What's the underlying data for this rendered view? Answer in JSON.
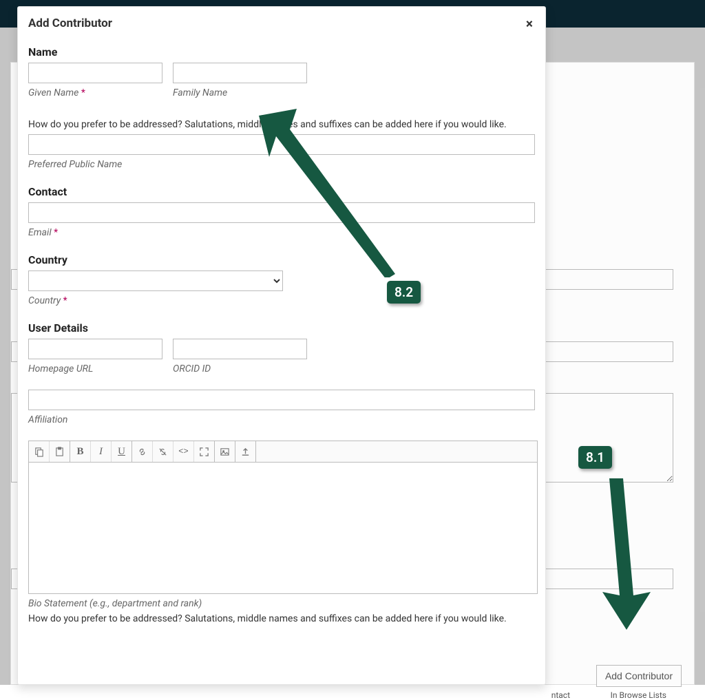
{
  "modal": {
    "title": "Add Contributor",
    "close_glyph": "×",
    "sections": {
      "name": {
        "heading": "Name",
        "given_label": "Given Name",
        "family_label": "Family Name",
        "helper": "How do you prefer to be addressed? Salutations, middle names and suffixes can be added here if you would like.",
        "preferred_label": "Preferred Public Name"
      },
      "contact": {
        "heading": "Contact",
        "email_label": "Email"
      },
      "country": {
        "heading": "Country",
        "country_label": "Country"
      },
      "user_details": {
        "heading": "User Details",
        "homepage_label": "Homepage URL",
        "orcid_label": "ORCID ID",
        "affiliation_label": "Affiliation",
        "bio_label": "Bio Statement (e.g., department and rank)",
        "helper2": "How do you prefer to be addressed? Salutations, middle names and suffixes can be added here if you would like."
      }
    },
    "required_glyph": "*"
  },
  "editor_icons": {
    "copy": "copy-icon",
    "paste": "paste-icon",
    "bold": "B",
    "italic": "I",
    "underline": "U",
    "link": "link-icon",
    "unlink": "unlink-icon",
    "code": "<>",
    "fullscreen": "fullscreen-icon",
    "image": "image-icon",
    "upload": "upload-icon"
  },
  "bg": {
    "add_contributor_button": "Add Contributor",
    "col_contact": "ntact",
    "col_browse": "In Browse Lists"
  },
  "annotations": {
    "a81": "8.1",
    "a82": "8.2"
  },
  "colors": {
    "arrow": "#165841"
  }
}
